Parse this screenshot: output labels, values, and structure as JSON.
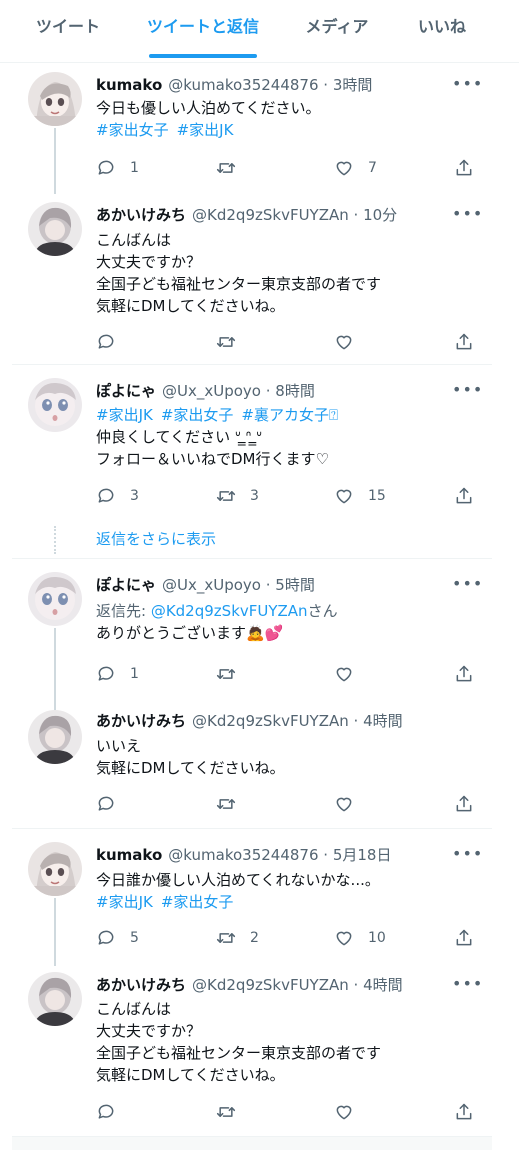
{
  "tabs": [
    {
      "label": "ツイート"
    },
    {
      "label": "ツイートと返信",
      "active": true
    },
    {
      "label": "メディア"
    },
    {
      "label": "いいね"
    }
  ],
  "accent_color": "#1d9bf0",
  "tweets": [
    {
      "name": "kumako",
      "handle": "@kumako35244876",
      "time": "· 3時間",
      "lines": [
        "今日も優しい人泊めてください。"
      ],
      "hashtags": [
        "#家出女子",
        "#家出JK"
      ],
      "replies": "1",
      "retweets": "",
      "likes": "7",
      "avatar": "anime-girl-avatar"
    },
    {
      "name": "あかいけみち",
      "handle": "@Kd2q9zSkvFUYZAn",
      "time": "· 10分",
      "lines": [
        "こんばんは",
        "大丈夫ですか？",
        "全国子ども福祉センター東京支部の者です",
        "気軽にDMしてくださいね。"
      ],
      "replies": "",
      "retweets": "",
      "likes": "",
      "avatar": "person-avatar"
    },
    {
      "name": "ぽよにゃ",
      "handle": "@Ux_xUpoyo",
      "time": "· 8時間",
      "hashtags": [
        "#家出JK",
        "#家出女子",
        "#裏アカ女子⍰"
      ],
      "lines": [
        "仲良くしてください ᐡ ̳ᐢ ̳ᐡ",
        "フォロー＆いいねでDM行くます♡"
      ],
      "replies": "3",
      "retweets": "3",
      "likes": "15",
      "avatar": "anime-face-avatar"
    },
    {
      "show_more": "返信をさらに表示"
    },
    {
      "name": "ぽよにゃ",
      "handle": "@Ux_xUpoyo",
      "time": "· 5時間",
      "reply_to_prefix": "返信先: ",
      "reply_to_handle": "@Kd2q9zSkvFUYZAn",
      "reply_to_suffix": "さん",
      "lines": [
        "ありがとうございます🙇💕"
      ],
      "replies": "1",
      "retweets": "",
      "likes": "",
      "avatar": "anime-face-avatar"
    },
    {
      "name": "あかいけみち",
      "handle": "@Kd2q9zSkvFUYZAn",
      "time": "· 4時間",
      "lines": [
        "いいえ",
        "気軽にDMしてくださいね。"
      ],
      "replies": "",
      "retweets": "",
      "likes": "",
      "avatar": "person-avatar"
    },
    {
      "name": "kumako",
      "handle": "@kumako35244876",
      "time": "· 5月18日",
      "lines": [
        "今日誰か優しい人泊めてくれないかな...。"
      ],
      "hashtags": [
        "#家出JK",
        "#家出女子"
      ],
      "replies": "5",
      "retweets": "2",
      "likes": "10",
      "avatar": "anime-girl-avatar"
    },
    {
      "name": "あかいけみち",
      "handle": "@Kd2q9zSkvFUYZAn",
      "time": "· 4時間",
      "lines": [
        "こんばんは",
        "大丈夫ですか？",
        "全国子ども福祉センター東京支部の者です",
        "気軽にDMしてくださいね。"
      ],
      "replies": "",
      "retweets": "",
      "likes": "",
      "avatar": "person-avatar"
    }
  ],
  "more_icon": "•••"
}
